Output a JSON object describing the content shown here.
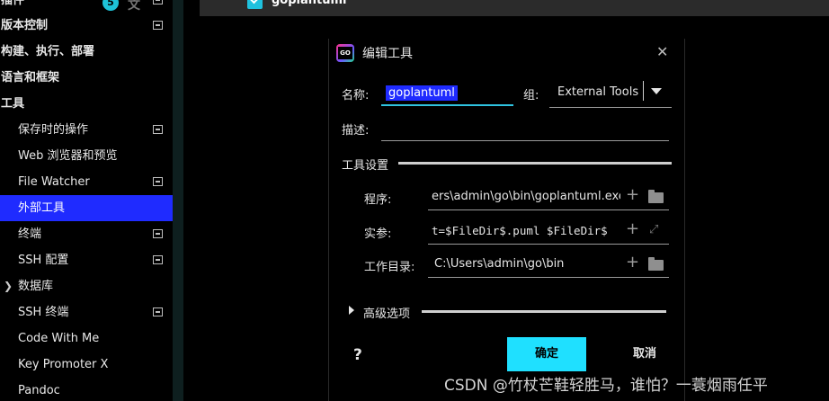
{
  "top_bar": {
    "checked_item_label": "goplantuml"
  },
  "sidebar": {
    "badge_count": "5",
    "items": [
      {
        "label": "插件",
        "level": "top"
      },
      {
        "label": "版本控制",
        "level": "top",
        "mark": true
      },
      {
        "label": "构建、执行、部署",
        "level": "top"
      },
      {
        "label": "语言和框架",
        "level": "top"
      },
      {
        "label": "工具",
        "level": "top"
      },
      {
        "label": "保存时的操作",
        "level": "sub",
        "mark": true
      },
      {
        "label": "Web 浏览器和预览",
        "level": "sub"
      },
      {
        "label": "File Watcher",
        "level": "sub",
        "mark": true
      },
      {
        "label": "外部工具",
        "level": "sub",
        "selected": true
      },
      {
        "label": "终端",
        "level": "sub",
        "mark": true
      },
      {
        "label": "SSH 配置",
        "level": "sub",
        "mark": true
      },
      {
        "label": "数据库",
        "level": "sub",
        "expandable": true
      },
      {
        "label": "SSH 终端",
        "level": "sub",
        "mark": true
      },
      {
        "label": "Code With Me",
        "level": "sub"
      },
      {
        "label": "Key Promoter X",
        "level": "sub"
      },
      {
        "label": "Pandoc",
        "level": "sub"
      }
    ]
  },
  "dialog": {
    "title": "编辑工具",
    "name_label": "名称:",
    "name_value": "goplantuml",
    "group_label": "组:",
    "group_value": "External Tools",
    "description_label": "描述:",
    "description_value": "",
    "tool_settings_label": "工具设置",
    "program_label": "程序:",
    "program_value": "ers\\admin\\go\\bin\\goplantuml.exe",
    "arguments_label": "实参:",
    "arguments_value": "t=$FileDir$.puml $FileDir$",
    "working_dir_label": "工作目录:",
    "working_dir_value": "C:\\Users\\admin\\go\\bin",
    "advanced_label": "高级选项",
    "help_label": "?",
    "ok_label": "确定",
    "cancel_label": "取消"
  },
  "watermark": "CSDN @竹杖芒鞋轻胜马，谁怕？一蓑烟雨任平",
  "colors": {
    "selection": "#1f2bff",
    "accent": "#1fe0ff",
    "focus_underline": "#2fc3e0"
  },
  "icons": [
    "goland-logo-icon",
    "close-icon",
    "dropdown-arrow-icon",
    "plus-icon",
    "folder-icon",
    "expand-icon",
    "chevron-right-icon",
    "help-icon"
  ]
}
